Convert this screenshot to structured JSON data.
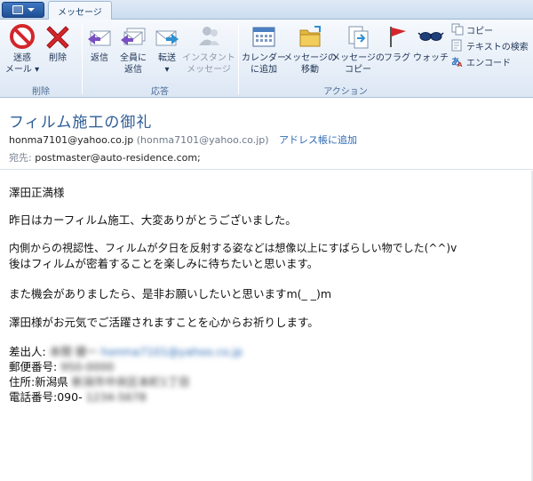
{
  "ribbon": {
    "tab_label": "メッセージ",
    "groups": {
      "delete": "削除",
      "respond": "応答",
      "actions": "アクション"
    },
    "buttons": {
      "junk_line1": "迷惑",
      "junk_line2": "メール ▾",
      "delete": "削除",
      "reply": "返信",
      "reply_all_line1": "全員に",
      "reply_all_line2": "返信",
      "forward_line1": "転送",
      "forward_line2": "▾",
      "im_line1": "インスタント",
      "im_line2": "メッセージ",
      "calendar_line1": "カレンダー",
      "calendar_line2": "に追加",
      "move_line1": "メッセージの",
      "move_line2": "移動",
      "copy_msg_line1": "メッセージの",
      "copy_msg_line2": "コピー",
      "flag": "フラグ",
      "watch": "ウォッチ",
      "copy": "コピー",
      "find_text": "テキストの検索",
      "encode": "エンコード"
    },
    "icons": {
      "junk": "no-entry-icon",
      "delete": "red-x-icon",
      "reply": "reply-envelope-icon",
      "reply_all": "reply-all-envelope-icon",
      "forward": "forward-envelope-icon",
      "im": "person-icon",
      "calendar": "calendar-icon",
      "move": "folder-move-icon",
      "copy_msg": "document-copy-icon",
      "flag": "red-flag-icon",
      "watch": "eyeglasses-icon",
      "copy": "copy-icon",
      "find_text": "find-text-icon",
      "encode": "encode-icon"
    }
  },
  "message": {
    "subject": "フィルム施工の御礼",
    "from_email": "honma7101@yahoo.co.jp",
    "from_paren": "(honma7101@yahoo.co.jp)",
    "add_to_contacts": "アドレス帳に追加",
    "to_label": "宛先:",
    "to_value": "postmaster@auto-residence.com;"
  },
  "body": {
    "greeting": "澤田正満様",
    "p1": "昨日はカーフィルム施工、大変ありがとうございました。",
    "p2a": "内側からの視認性、フィルムが夕日を反射する姿などは想像以上にすばらしい物でした(^^)v",
    "p2b": "後はフィルムが密着することを楽しみに待ちたいと思います。",
    "p3": "また機会がありましたら、是非お願いしたいと思いますm(_ _)m",
    "p4": "澤田様がお元気でご活躍されますことを心からお祈りします。",
    "sig_sender_label": "差出人:",
    "sig_sender_name": "本間 健一",
    "sig_sender_email": "honma7101@yahoo.co.jp",
    "sig_zip_label": "郵便番号:",
    "sig_zip_value": "950-0000",
    "sig_addr_label": "住所:新潟県",
    "sig_addr_value": "新潟市中央区本町1丁目",
    "sig_tel_label": "電話番号:090-",
    "sig_tel_value": "1234-5678"
  },
  "colors": {
    "subject": "#2d5c96",
    "link": "#2d6bb5",
    "ribbon_top": "#f6f9fd",
    "ribbon_bottom": "#dce7f4"
  }
}
